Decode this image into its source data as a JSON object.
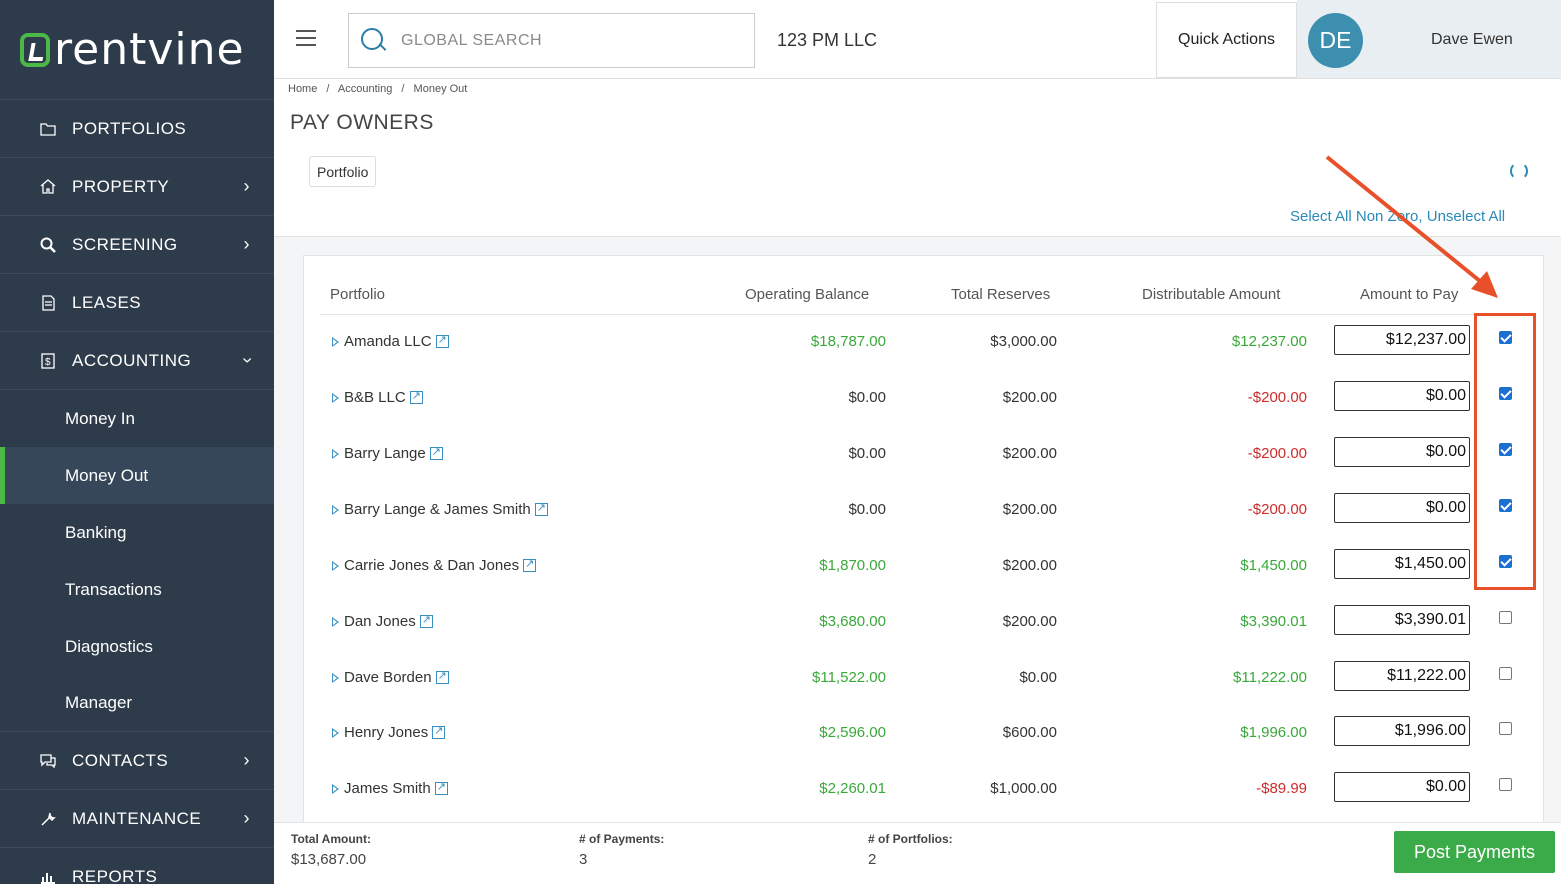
{
  "app": {
    "brand": "rentvine",
    "company": "123 PM LLC"
  },
  "search": {
    "placeholder": "GLOBAL SEARCH"
  },
  "header": {
    "quick_actions": "Quick Actions",
    "avatar_initials": "DE",
    "user_name": "Dave Ewen"
  },
  "sidebar": {
    "items": [
      {
        "label": "PORTFOLIOS",
        "icon": "folder-icon"
      },
      {
        "label": "PROPERTY",
        "icon": "home-icon"
      },
      {
        "label": "SCREENING",
        "icon": "magnify-icon"
      },
      {
        "label": "LEASES",
        "icon": "document-icon"
      },
      {
        "label": "ACCOUNTING",
        "icon": "dollar-icon"
      },
      {
        "label": "CONTACTS",
        "icon": "chat-icon"
      },
      {
        "label": "MAINTENANCE",
        "icon": "wrench-icon"
      },
      {
        "label": "REPORTS",
        "icon": "chart-icon"
      }
    ],
    "accounting_sub": [
      "Money In",
      "Money Out",
      "Banking",
      "Transactions",
      "Diagnostics",
      "Manager"
    ]
  },
  "breadcrumb": [
    "Home",
    "/",
    "Accounting",
    "/",
    "Money Out"
  ],
  "page": {
    "title": "PAY OWNERS",
    "filter_chip": "Portfolio",
    "select_all_nonzero": "Select All Non Zero",
    "select_sep": ",",
    "unselect_all": "Unselect All"
  },
  "table": {
    "columns": [
      "Portfolio",
      "Operating Balance",
      "Total Reserves",
      "Distributable Amount",
      "Amount to Pay"
    ],
    "rows": [
      {
        "name": "Amanda LLC",
        "operating": "$18,787.00",
        "reserves": "$3,000.00",
        "distributable": "$12,237.00",
        "amount": "$12,237.00",
        "checked": true,
        "op_color": "green",
        "dist_color": "green"
      },
      {
        "name": "B&B LLC",
        "operating": "$0.00",
        "reserves": "$200.00",
        "distributable": "-$200.00",
        "amount": "$0.00",
        "checked": true,
        "op_color": "dark",
        "dist_color": "red"
      },
      {
        "name": "Barry Lange",
        "operating": "$0.00",
        "reserves": "$200.00",
        "distributable": "-$200.00",
        "amount": "$0.00",
        "checked": true,
        "op_color": "dark",
        "dist_color": "red"
      },
      {
        "name": "Barry Lange & James Smith",
        "operating": "$0.00",
        "reserves": "$200.00",
        "distributable": "-$200.00",
        "amount": "$0.00",
        "checked": true,
        "op_color": "dark",
        "dist_color": "red"
      },
      {
        "name": "Carrie Jones & Dan Jones",
        "operating": "$1,870.00",
        "reserves": "$200.00",
        "distributable": "$1,450.00",
        "amount": "$1,450.00",
        "checked": true,
        "op_color": "green",
        "dist_color": "green"
      },
      {
        "name": "Dan Jones",
        "operating": "$3,680.00",
        "reserves": "$200.00",
        "distributable": "$3,390.01",
        "amount": "$3,390.01",
        "checked": false,
        "op_color": "green",
        "dist_color": "green"
      },
      {
        "name": "Dave Borden",
        "operating": "$11,522.00",
        "reserves": "$0.00",
        "distributable": "$11,222.00",
        "amount": "$11,222.00",
        "checked": false,
        "op_color": "green",
        "dist_color": "green"
      },
      {
        "name": "Henry Jones",
        "operating": "$2,596.00",
        "reserves": "$600.00",
        "distributable": "$1,996.00",
        "amount": "$1,996.00",
        "checked": false,
        "op_color": "green",
        "dist_color": "green"
      },
      {
        "name": "James Smith",
        "operating": "$2,260.01",
        "reserves": "$1,000.00",
        "distributable": "-$89.99",
        "amount": "$0.00",
        "checked": false,
        "op_color": "green",
        "dist_color": "red"
      }
    ]
  },
  "footer": {
    "total_label": "Total Amount:",
    "total_value": "$13,687.00",
    "payments_label": "# of Payments:",
    "payments_value": "3",
    "portfolios_label": "# of Portfolios:",
    "portfolios_value": "2",
    "post_button": "Post Payments"
  },
  "colors": {
    "sidebar_bg": "#2e3b4a",
    "accent_green": "#4cb848",
    "link_blue": "#2a8ab8",
    "annotation": "#e8502a",
    "positive": "#3aa83a",
    "negative": "#d02b2b"
  }
}
